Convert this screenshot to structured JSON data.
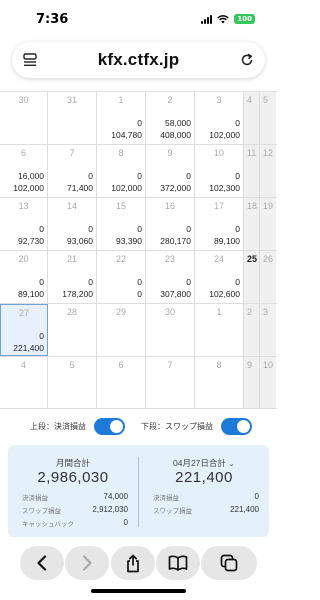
{
  "status": {
    "time": "7:36",
    "battery": "100"
  },
  "browser": {
    "url": "kfx.ctfx.jp"
  },
  "calendar": {
    "rows": [
      {
        "main": [
          {
            "day": "30",
            "v1": "",
            "v2": ""
          },
          {
            "day": "31",
            "v1": "",
            "v2": ""
          },
          {
            "day": "1",
            "v1": "0",
            "v2": "104,780"
          },
          {
            "day": "2",
            "v1": "58,000",
            "v2": "408,000"
          },
          {
            "day": "3",
            "v1": "0",
            "v2": "102,000"
          }
        ],
        "sat": "4",
        "sun": "5"
      },
      {
        "main": [
          {
            "day": "6",
            "v1": "16,000",
            "v2": "102,000"
          },
          {
            "day": "7",
            "v1": "0",
            "v2": "71,400"
          },
          {
            "day": "8",
            "v1": "0",
            "v2": "102,000"
          },
          {
            "day": "9",
            "v1": "0",
            "v2": "372,000"
          },
          {
            "day": "10",
            "v1": "0",
            "v2": "102,300"
          }
        ],
        "sat": "11",
        "sun": "12"
      },
      {
        "main": [
          {
            "day": "13",
            "v1": "0",
            "v2": "92,730"
          },
          {
            "day": "14",
            "v1": "0",
            "v2": "93,060"
          },
          {
            "day": "15",
            "v1": "0",
            "v2": "93,390"
          },
          {
            "day": "16",
            "v1": "0",
            "v2": "280,170"
          },
          {
            "day": "17",
            "v1": "0",
            "v2": "89,100"
          }
        ],
        "sat": "18",
        "sun": "19"
      },
      {
        "main": [
          {
            "day": "20",
            "v1": "0",
            "v2": "89,100"
          },
          {
            "day": "21",
            "v1": "0",
            "v2": "178,200"
          },
          {
            "day": "22",
            "v1": "0",
            "v2": "0"
          },
          {
            "day": "23",
            "v1": "0",
            "v2": "307,800"
          },
          {
            "day": "24",
            "v1": "0",
            "v2": "102,600"
          }
        ],
        "sat": "25",
        "sun": "26"
      },
      {
        "main": [
          {
            "day": "27",
            "v1": "0",
            "v2": "221,400"
          },
          {
            "day": "28",
            "v1": "",
            "v2": ""
          },
          {
            "day": "29",
            "v1": "",
            "v2": ""
          },
          {
            "day": "30",
            "v1": "",
            "v2": ""
          },
          {
            "day": "1",
            "v1": "",
            "v2": ""
          }
        ],
        "sat": "2",
        "sun": "3"
      },
      {
        "main": [
          {
            "day": "4",
            "v1": "",
            "v2": ""
          },
          {
            "day": "5",
            "v1": "",
            "v2": ""
          },
          {
            "day": "6",
            "v1": "",
            "v2": ""
          },
          {
            "day": "7",
            "v1": "",
            "v2": ""
          },
          {
            "day": "8",
            "v1": "",
            "v2": ""
          }
        ],
        "sat": "9",
        "sun": "10"
      }
    ]
  },
  "toggles": {
    "upper_label": "上段：決済損益",
    "lower_label": "下段：スワップ損益"
  },
  "summary": {
    "monthly": {
      "title": "月間合計",
      "total": "2,986,030",
      "settle_label": "決済損益",
      "settle_value": "74,000",
      "swap_label": "スワップ損益",
      "swap_value": "2,912,030",
      "cashback_label": "キャッシュバック",
      "cashback_value": "0"
    },
    "daily": {
      "title": "04月27日合計",
      "total": "221,400",
      "settle_label": "決済損益",
      "settle_value": "0",
      "swap_label": "スワップ損益",
      "swap_value": "221,400"
    }
  }
}
